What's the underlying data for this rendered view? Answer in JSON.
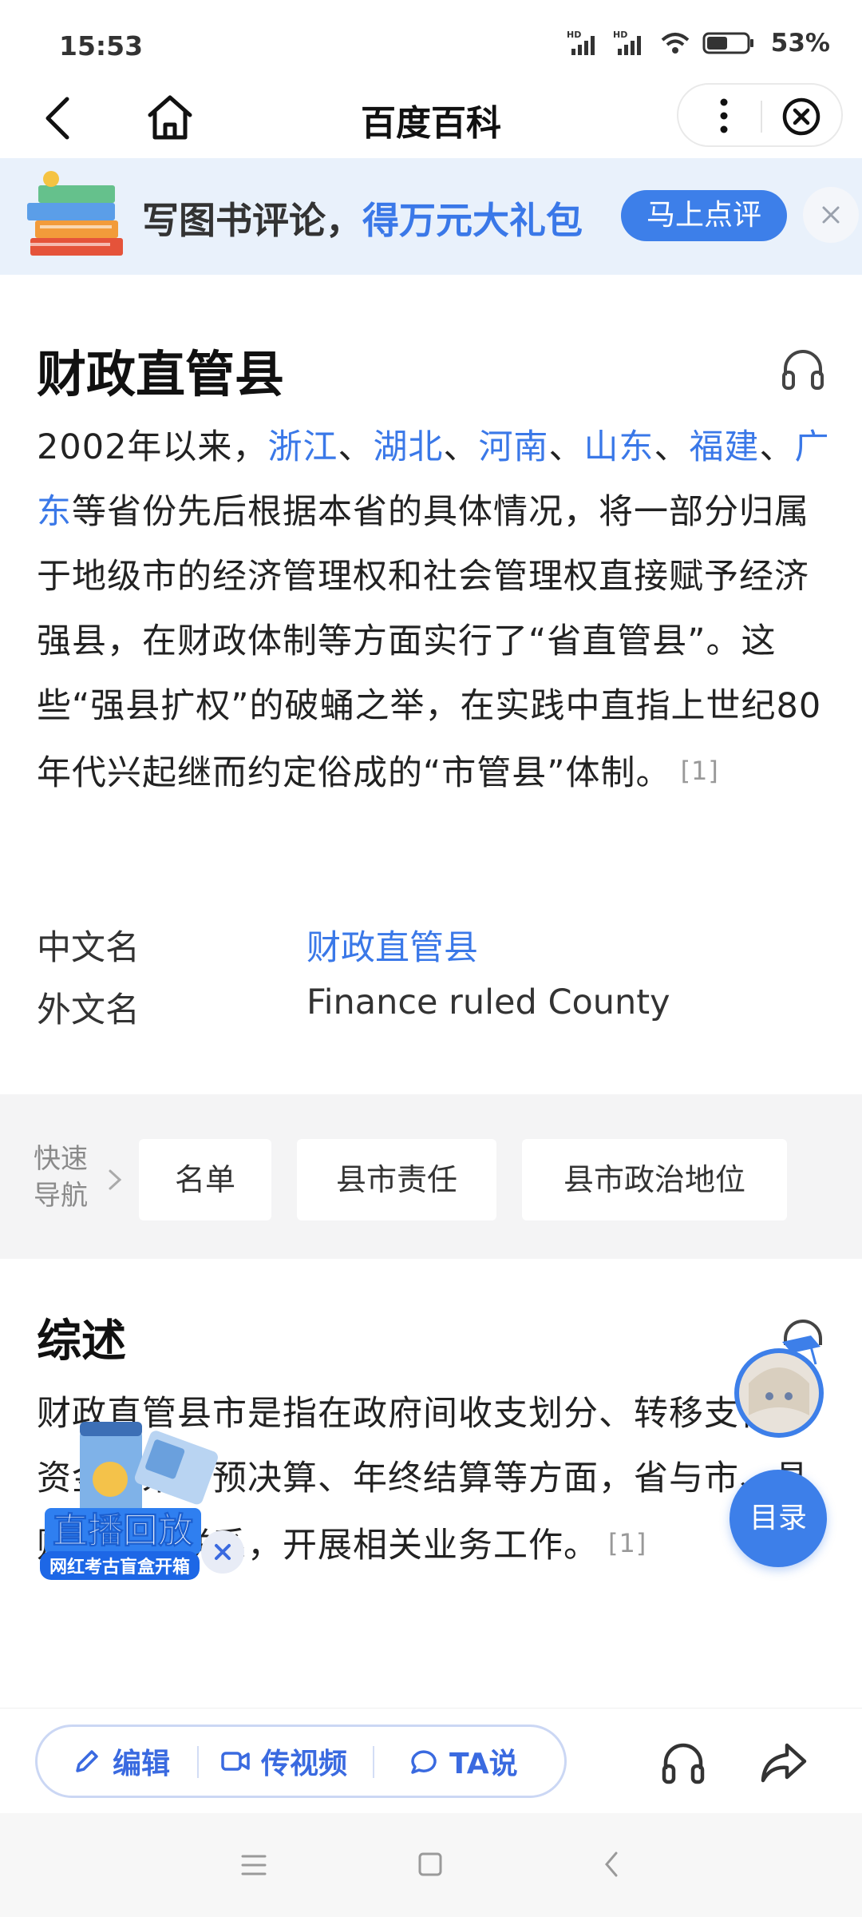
{
  "status_bar": {
    "time": "15:53",
    "signal1_label": "HD",
    "signal2_label": "HD",
    "battery_percent": "53%",
    "battery_level": 0.53
  },
  "nav": {
    "title": "百度百科"
  },
  "banner": {
    "text_prefix": "写图书评论，",
    "text_highlight": "得万元大礼包",
    "button_label": "马上点评"
  },
  "article": {
    "title": "财政直管县",
    "intro": {
      "part1": "2002年以来，",
      "link_zhejiang": "浙江",
      "sep1": "、",
      "link_hubei": "湖北",
      "sep2": "、",
      "link_henan": "河南",
      "sep3": "、",
      "link_shandong": "山东",
      "sep4": "、",
      "link_fujian": "福建",
      "sep5": "、",
      "link_guangdong": "广东",
      "part2": "等省份先后根据本省的具体情况，将一部分归属于地级市的经济管理权和社会管理权直接赋予经济强县，在财政体制等方面实行了“省直管县”。这些“强县扩权”的破蛹之举，在实践中直指上世纪80年代兴起继而约定俗成的“市管县”体制。",
      "ref": "[1]"
    },
    "info": [
      {
        "label": "中文名",
        "value": "财政直管县"
      },
      {
        "label": "外文名",
        "value": "Finance ruled County"
      }
    ],
    "quick_nav": {
      "label": "快速导航",
      "chips": [
        "名单",
        "县市责任",
        "县市政治地位"
      ]
    },
    "section": {
      "title": "综述",
      "text": "财政直管县市是指在政府间收支划分、转移支付、资金往来、预决算、年终结算等方面，省与市、县财政直接联系，开展相关业务工作。",
      "ref": "[1]"
    }
  },
  "live_card": {
    "title": "直播回放",
    "subtitle": "网红考古盲盒开箱"
  },
  "toc_button": "目录",
  "action_bar": {
    "edit": "编辑",
    "video": "传视频",
    "ta": "TA说"
  }
}
